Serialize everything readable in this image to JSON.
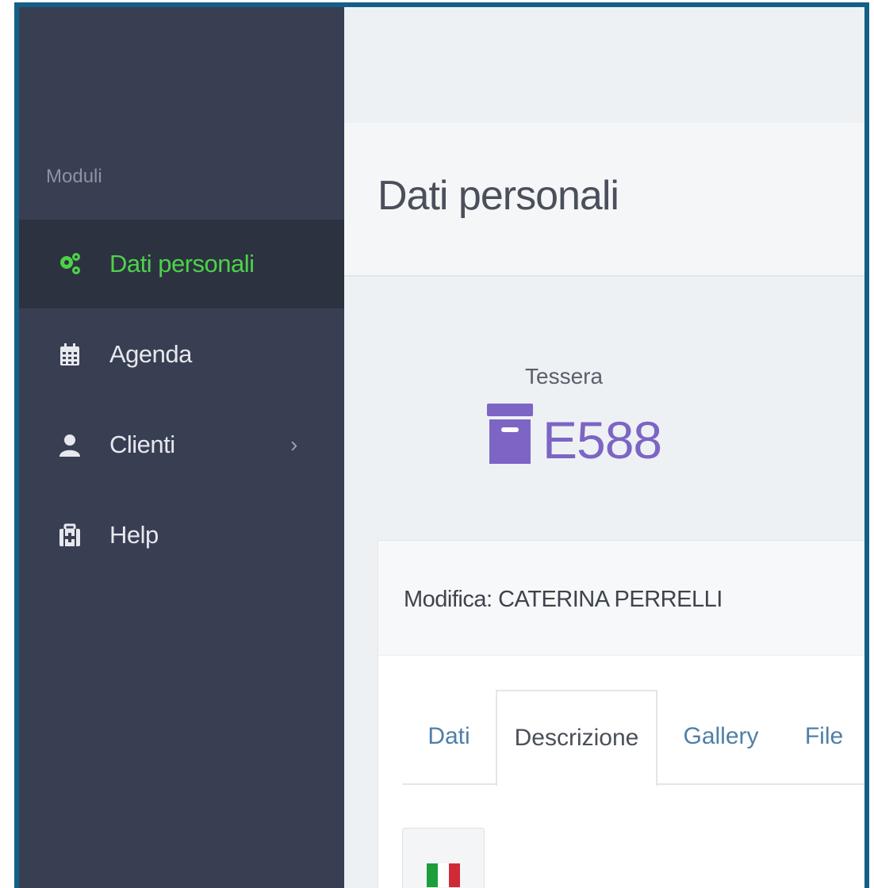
{
  "sidebar": {
    "section_label": "Moduli",
    "items": [
      {
        "label": "Dati personali",
        "icon": "gears-icon",
        "active": true
      },
      {
        "label": "Agenda",
        "icon": "calendar-icon",
        "active": false
      },
      {
        "label": "Clienti",
        "icon": "user-icon",
        "active": false,
        "has_submenu": true
      },
      {
        "label": "Help",
        "icon": "medkit-icon",
        "active": false
      }
    ],
    "chevron": "›"
  },
  "page": {
    "title": "Dati personali"
  },
  "stat": {
    "label": "Tessera",
    "value": "E588",
    "icon": "archive-icon"
  },
  "panel": {
    "title": "Modifica: CATERINA PERRELLI",
    "tabs": [
      {
        "label": "Dati",
        "active": false
      },
      {
        "label": "Descrizione",
        "active": true
      },
      {
        "label": "Gallery",
        "active": false
      },
      {
        "label": "File",
        "active": false
      }
    ],
    "language_flag": "italy-flag-icon"
  },
  "colors": {
    "sidebar_bg": "#393f52",
    "sidebar_active_bg": "#2d3240",
    "active_green": "#4cd24a",
    "accent_purple": "#7c65c4",
    "link_blue": "#4f7fa8",
    "frame_border": "#145f86"
  }
}
